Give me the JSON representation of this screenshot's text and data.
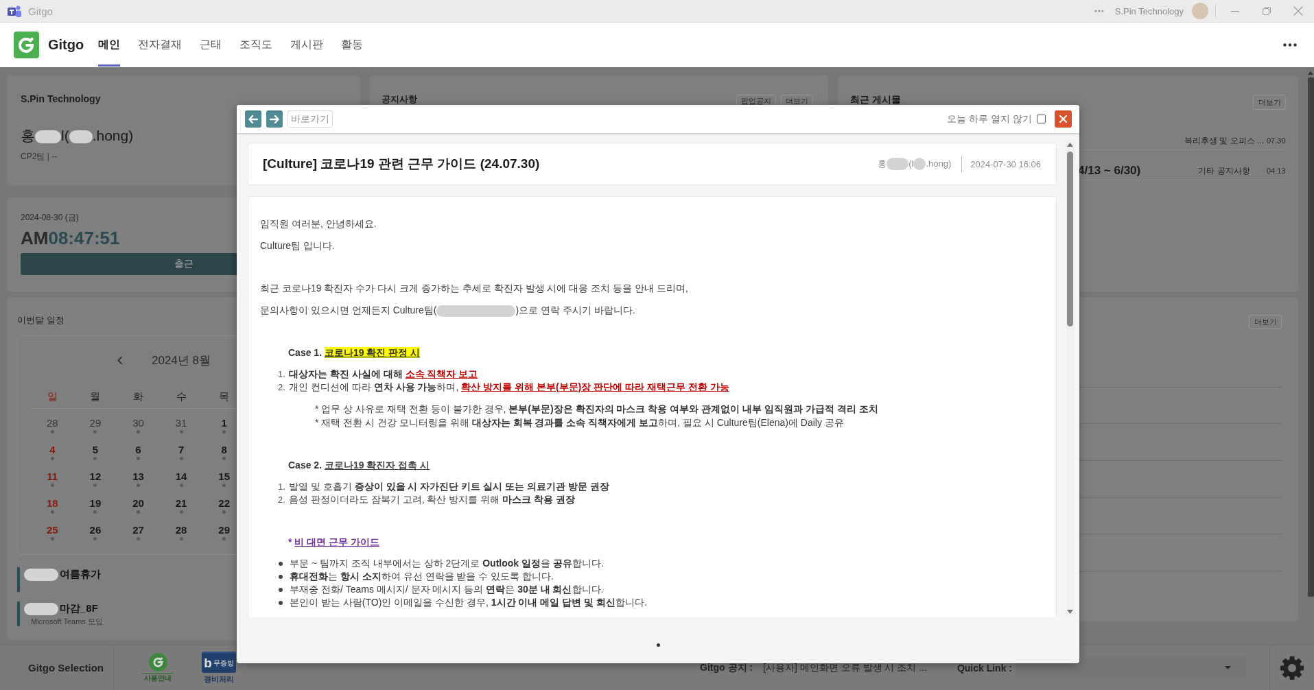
{
  "title_bar": {
    "app_title": "Gitgo",
    "account": "S.Pin Technology"
  },
  "header": {
    "brand": "Gitgo",
    "tabs": [
      {
        "label": "메인",
        "selected": true
      },
      {
        "label": "전자결재",
        "selected": false
      },
      {
        "label": "근태",
        "selected": false
      },
      {
        "label": "조직도",
        "selected": false
      },
      {
        "label": "게시판",
        "selected": false
      },
      {
        "label": "활동",
        "selected": false
      }
    ]
  },
  "profile": {
    "company": "S.Pin Technology",
    "name_parts": [
      "홍",
      "l(",
      ".hong)"
    ],
    "team": "CP2팀 | --"
  },
  "attendance": {
    "date": "2024-08-30 (금)",
    "meridiem": "AM",
    "time": "08:47:51",
    "button": "출근"
  },
  "notices": {
    "title": "공지사항",
    "buttons": [
      "팝업공지",
      "더보기"
    ]
  },
  "recent_posts": {
    "title": "최근 게시물",
    "more": "더보기",
    "rows": [
      {
        "category": "복리후생 및 오피스 ...",
        "date": "07.30"
      },
      {
        "title": "4/13 ~ 6/30)",
        "category": "기타 공지사항",
        "date": "04.13"
      }
    ]
  },
  "schedule": {
    "title": "이번달 일정",
    "month": "2024년 8월",
    "weekdays": [
      {
        "label": "일",
        "kind": "sunday"
      },
      {
        "label": "월",
        "kind": "weekday"
      },
      {
        "label": "화",
        "kind": "weekday"
      },
      {
        "label": "수",
        "kind": "weekday"
      },
      {
        "label": "목",
        "kind": "weekday"
      }
    ],
    "weeks": [
      [
        {
          "day": "28",
          "kind": "other"
        },
        {
          "day": "29",
          "kind": "other"
        },
        {
          "day": "30",
          "kind": "other"
        },
        {
          "day": "31",
          "kind": "other"
        },
        {
          "day": "1",
          "kind": "weekday"
        }
      ],
      [
        {
          "day": "4",
          "kind": "sunday"
        },
        {
          "day": "5",
          "kind": "weekday"
        },
        {
          "day": "6",
          "kind": "weekday"
        },
        {
          "day": "7",
          "kind": "weekday"
        },
        {
          "day": "8",
          "kind": "weekday"
        }
      ],
      [
        {
          "day": "11",
          "kind": "sunday"
        },
        {
          "day": "12",
          "kind": "weekday"
        },
        {
          "day": "13",
          "kind": "weekday"
        },
        {
          "day": "14",
          "kind": "weekday"
        },
        {
          "day": "15",
          "kind": "weekday"
        }
      ],
      [
        {
          "day": "18",
          "kind": "sunday"
        },
        {
          "day": "19",
          "kind": "weekday"
        },
        {
          "day": "20",
          "kind": "weekday"
        },
        {
          "day": "21",
          "kind": "weekday"
        },
        {
          "day": "22",
          "kind": "weekday"
        }
      ],
      [
        {
          "day": "25",
          "kind": "sunday"
        },
        {
          "day": "26",
          "kind": "weekday"
        },
        {
          "day": "27",
          "kind": "weekday"
        },
        {
          "day": "28",
          "kind": "weekday"
        },
        {
          "day": "29",
          "kind": "weekday"
        }
      ]
    ],
    "events": [
      {
        "title": "여름휴가",
        "redacted": true
      },
      {
        "title": "마감_8F",
        "redacted": true,
        "subtitle": "Microsoft Teams 모임"
      }
    ]
  },
  "board": {
    "more": "더보기"
  },
  "bottom_bar": {
    "title": "Gitgo Selection",
    "shortcuts": [
      {
        "kind": "guide",
        "label": "사용안내"
      },
      {
        "kind": "expense",
        "badge_mark": "b",
        "badge_text": "무증빙",
        "label": "경비처리"
      }
    ],
    "notice_label": "Gitgo 공지 :",
    "notice": "[사용자] 메인화면 오류 발생 시 조치 ...",
    "quick_link_label": "Quick Link :"
  },
  "modal": {
    "shortcut": "바로가기",
    "dont_show": {
      "label": "오늘 하루 열지 않기",
      "checked": false
    },
    "post": {
      "title": "[Culture] 코로나19 관련 근무 가이드 (24.07.30)",
      "author_parts": [
        "홍",
        "(l",
        ".hong)"
      ],
      "date": "2024-07-30 16:06",
      "sections": [
        [
          {
            "kind": "paragraph",
            "segments": [
              {
                "text": "임직원 여러분, 안녕하세요."
              }
            ]
          },
          {
            "kind": "paragraph",
            "segments": [
              {
                "text": "Culture팀 입니다."
              }
            ]
          }
        ],
        [
          {
            "kind": "paragraph",
            "segments": [
              {
                "text": "최근 코로나19 확진자 수가 다시 크게 증가하는 추세로 확진자 발생 시에 대응 조치 등을 안내 드리며,"
              }
            ]
          },
          {
            "kind": "paragraph",
            "segments": [
              {
                "text": "문의사항이 있으시면 언제든지 Culture팀("
              },
              {
                "kind": "redaction"
              },
              {
                "text": ")으로 연락 주시기 바랍니다."
              }
            ]
          }
        ],
        [
          {
            "kind": "heading",
            "segments": [
              {
                "text": "**Case 1.** "
              },
              {
                "kind": "highlight",
                "text": "코로나19 확진 판정 시"
              }
            ]
          },
          {
            "kind": "numbered",
            "number": "1.",
            "segments": [
              {
                "text": "**대상자는 확진 사실에 대해** "
              },
              {
                "kind": "alert",
                "text": "소속 직책자 보고"
              }
            ]
          },
          {
            "kind": "numbered",
            "number": "2.",
            "segments": [
              {
                "text": "개인 컨디션에 따라 **연차 사용 가능**하며, "
              },
              {
                "kind": "alert",
                "text": "확산 방지를 위해 본부(부문)장 판단에 따라 재택근무 전환 가능"
              }
            ]
          },
          {
            "kind": "note",
            "segments": [
              {
                "text": "* 업무 상 사유로 재택 전환 등이 불가한 경우, **본부(부문)장은 확진자의 마스크 착용 여부와 관계없이 내부 임직원과 가급적 격리 조치**"
              }
            ]
          },
          {
            "kind": "note",
            "segments": [
              {
                "text": "* 재택 전환 시 건강 모니터링을 위해 **대상자는 회복 경과를 소속 직책자에게 보고**하며, 필요 시 Culture팀(Elena)에 Daily 공유"
              }
            ]
          }
        ],
        [
          {
            "kind": "heading",
            "segments": [
              {
                "text": "**Case 2.** "
              },
              {
                "kind": "underline",
                "text": "코로나19 확진자 접촉 시"
              }
            ]
          },
          {
            "kind": "numbered",
            "number": "1.",
            "segments": [
              {
                "text": "발열 및 호흡기 **증상이 있을 시 자가진단 키트 실시 또는 의료기관 방문 권장**"
              }
            ]
          },
          {
            "kind": "numbered",
            "number": "2.",
            "segments": [
              {
                "text": "음성 판정이더라도 잠복기 고려, 확산 방지를 위해 **마스크 착용 권장**"
              }
            ]
          }
        ],
        [
          {
            "kind": "heading",
            "segments": [
              {
                "kind": "accent",
                "text": "* "
              },
              {
                "kind": "accent-link",
                "text": "비 대면 근무 가이드"
              }
            ]
          },
          {
            "kind": "bullet",
            "segments": [
              {
                "text": "부문 ~ 팀까지 조직 내부에서는 상하 2단계로 **Outlook 일정**을 **공유**합니다."
              }
            ]
          },
          {
            "kind": "bullet",
            "segments": [
              {
                "text": "**휴대전화**는 **항시 소지**하여 유선 연락을 받을 수 있도록 합니다."
              }
            ]
          },
          {
            "kind": "bullet",
            "segments": [
              {
                "text": "부재중 전화/ Teams 메시지/ 문자 메시지 등의 **연락**은 **30분 내 회신**합니다."
              }
            ]
          },
          {
            "kind": "bullet",
            "segments": [
              {
                "text": "본인이 받는 사람(TO)인 이메일을 수신한 경우, **1시간 이내 메일 답변 및 회신**합니다."
              }
            ]
          }
        ]
      ]
    }
  }
}
